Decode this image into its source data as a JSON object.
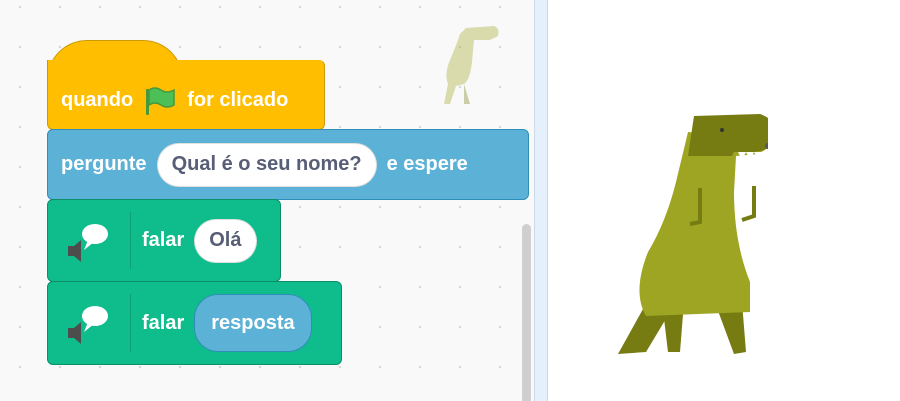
{
  "blocks": {
    "hat": {
      "label_when": "quando",
      "label_clicked": "for clicado"
    },
    "ask": {
      "label": "pergunte",
      "question": "Qual é o seu nome?",
      "label_wait": "e espere"
    },
    "say1": {
      "label": "falar",
      "value": "Olá"
    },
    "say2": {
      "label": "falar",
      "value": "resposta"
    }
  },
  "colors": {
    "events": "#ffbf00",
    "sensing": "#5cb1d6",
    "looks_extension": "#0fbd8c",
    "flag": "#4cbf56",
    "dino": "#9ea523",
    "dino_dark": "#767c12"
  },
  "icons": [
    "green-flag-icon",
    "speech-bubble-icon",
    "dinosaur-sprite"
  ]
}
